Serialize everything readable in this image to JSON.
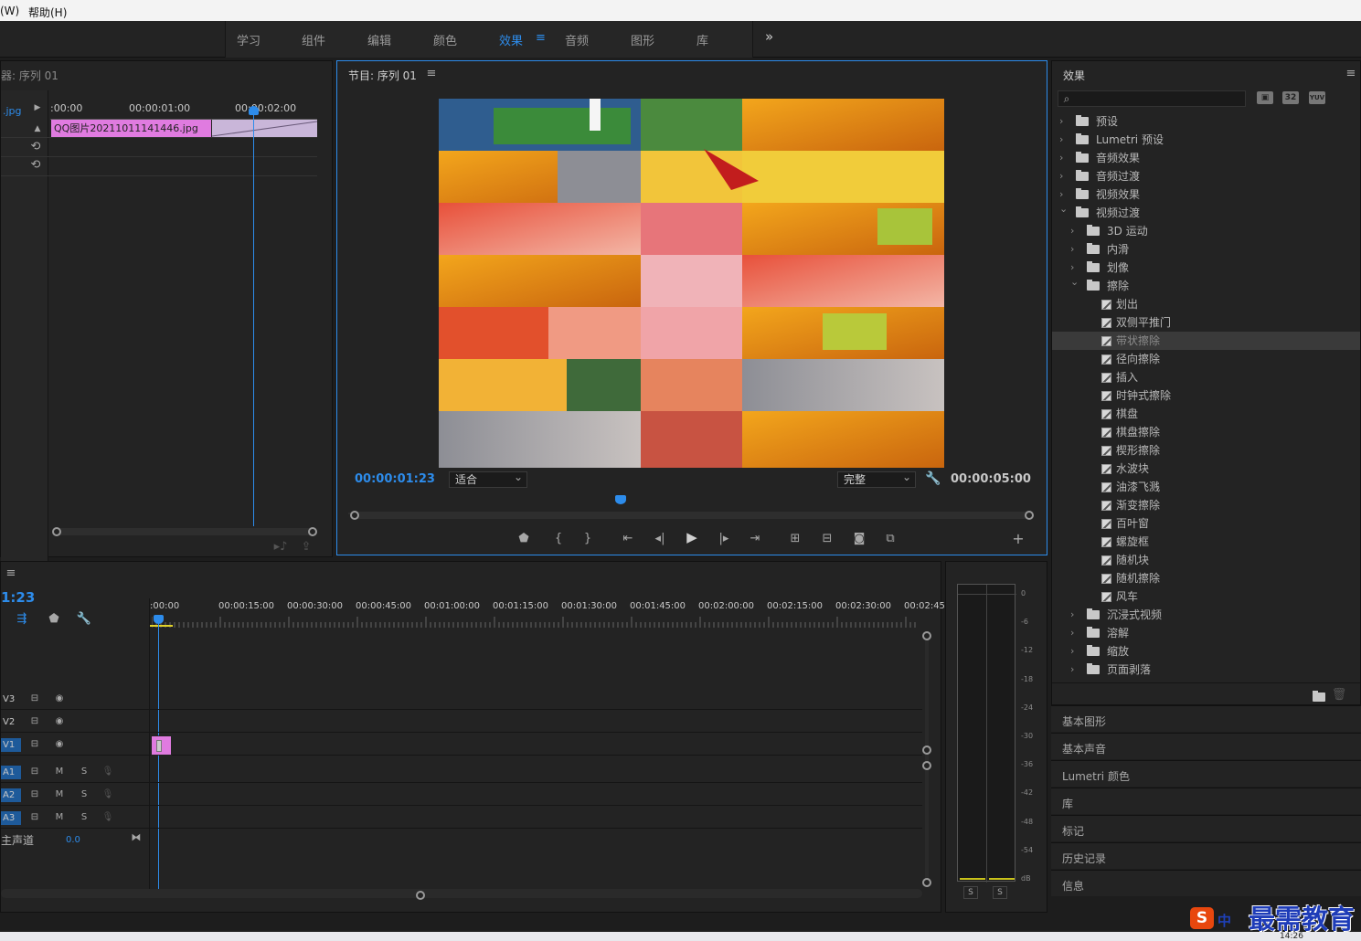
{
  "menu": [
    "(W)",
    "帮助(H)"
  ],
  "workspaces": [
    "学习",
    "组件",
    "编辑",
    "颜色",
    "效果",
    "音频",
    "图形",
    "库"
  ],
  "workspace_active": "效果",
  "workspace_overflow": "»",
  "source_monitor": {
    "title": "器: 序列 01",
    "clip_label": ".jpg",
    "ruler": [
      ":00:00",
      "00:00:01:00",
      "00:00:02:00"
    ],
    "clip_name": "QQ图片20211011141446.jpg"
  },
  "program_monitor": {
    "title": "节目: 序列 01",
    "timecode": "00:00:01:23",
    "fit": "适合",
    "quality": "完整",
    "duration": "00:00:05:00",
    "playhead_fraction": 0.39
  },
  "effects_panel": {
    "title": "效果",
    "search_placeholder": "",
    "badges": [
      "32",
      "YUV"
    ],
    "tree": [
      {
        "label": "预设",
        "level": 0,
        "type": "folder-star",
        "expanded": false
      },
      {
        "label": "Lumetri 预设",
        "level": 0,
        "type": "folder-star",
        "expanded": false
      },
      {
        "label": "音频效果",
        "level": 0,
        "type": "folder",
        "expanded": false
      },
      {
        "label": "音频过渡",
        "level": 0,
        "type": "folder",
        "expanded": false
      },
      {
        "label": "视频效果",
        "level": 0,
        "type": "folder",
        "expanded": false
      },
      {
        "label": "视频过渡",
        "level": 0,
        "type": "folder",
        "expanded": true
      },
      {
        "label": "3D 运动",
        "level": 1,
        "type": "folder",
        "expanded": false
      },
      {
        "label": "内滑",
        "level": 1,
        "type": "folder",
        "expanded": false
      },
      {
        "label": "划像",
        "level": 1,
        "type": "folder",
        "expanded": false
      },
      {
        "label": "擦除",
        "level": 1,
        "type": "folder",
        "expanded": true
      },
      {
        "label": "划出",
        "level": 2,
        "type": "effect"
      },
      {
        "label": "双侧平推门",
        "level": 2,
        "type": "effect"
      },
      {
        "label": "带状擦除",
        "level": 2,
        "type": "effect",
        "selected": true
      },
      {
        "label": "径向擦除",
        "level": 2,
        "type": "effect"
      },
      {
        "label": "插入",
        "level": 2,
        "type": "effect"
      },
      {
        "label": "时钟式擦除",
        "level": 2,
        "type": "effect"
      },
      {
        "label": "棋盘",
        "level": 2,
        "type": "effect"
      },
      {
        "label": "棋盘擦除",
        "level": 2,
        "type": "effect"
      },
      {
        "label": "楔形擦除",
        "level": 2,
        "type": "effect"
      },
      {
        "label": "水波块",
        "level": 2,
        "type": "effect"
      },
      {
        "label": "油漆飞溅",
        "level": 2,
        "type": "effect"
      },
      {
        "label": "渐变擦除",
        "level": 2,
        "type": "effect"
      },
      {
        "label": "百叶窗",
        "level": 2,
        "type": "effect"
      },
      {
        "label": "螺旋框",
        "level": 2,
        "type": "effect"
      },
      {
        "label": "随机块",
        "level": 2,
        "type": "effect"
      },
      {
        "label": "随机擦除",
        "level": 2,
        "type": "effect"
      },
      {
        "label": "风车",
        "level": 2,
        "type": "effect"
      },
      {
        "label": "沉浸式视频",
        "level": 1,
        "type": "folder",
        "expanded": false
      },
      {
        "label": "溶解",
        "level": 1,
        "type": "folder",
        "expanded": false
      },
      {
        "label": "缩放",
        "level": 1,
        "type": "folder",
        "expanded": false
      },
      {
        "label": "页面剥落",
        "level": 1,
        "type": "folder",
        "expanded": false
      }
    ]
  },
  "side_sections": [
    "基本图形",
    "基本声音",
    "Lumetri 颜色",
    "库",
    "标记",
    "历史记录",
    "信息"
  ],
  "timeline": {
    "timecode": "1:23",
    "ruler": [
      ":00:00",
      "00:00:15:00",
      "00:00:30:00",
      "00:00:45:00",
      "00:01:00:00",
      "00:01:15:00",
      "00:01:30:00",
      "00:01:45:00",
      "00:02:00:00",
      "00:02:15:00",
      "00:02:30:00",
      "00:02:45:"
    ],
    "tracks": [
      {
        "name": "V3",
        "kind": "video"
      },
      {
        "name": "V2",
        "kind": "video"
      },
      {
        "name": "V1",
        "kind": "video",
        "active": true
      },
      {
        "name": "A1",
        "kind": "audio",
        "active": true
      },
      {
        "name": "A2",
        "kind": "audio",
        "active": true
      },
      {
        "name": "A3",
        "kind": "audio",
        "active": true
      }
    ],
    "master_label": "主声道",
    "master_value": "0.0",
    "mute": "M",
    "solo": "S"
  },
  "audio_meter": {
    "scale": [
      "0",
      "-6",
      "-12",
      "-18",
      "-24",
      "-30",
      "-36",
      "-42",
      "-48",
      "-54",
      "dB"
    ],
    "solo_buttons": [
      "S",
      "S"
    ]
  },
  "watermark": {
    "brand": "最需教育",
    "ime": "中"
  },
  "taskbar_clock": "14:26",
  "colors": {
    "accent": "#2d8ceb",
    "clip": "#e07be0",
    "panel": "#232323",
    "selected": "#3a3a3a"
  }
}
